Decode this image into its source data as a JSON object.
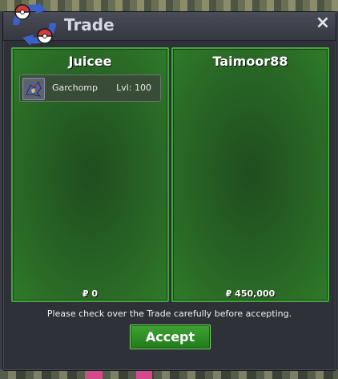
{
  "window": {
    "title": "Trade",
    "close_glyph": "×"
  },
  "left_panel": {
    "player_name": "Juicee",
    "pokemon": [
      {
        "name": "Garchomp",
        "level_text": "Lvl: 100",
        "icon": "garchomp-sprite-icon"
      }
    ],
    "money": "₽ 0"
  },
  "right_panel": {
    "player_name": "Taimoor88",
    "money": "₽ 450,000"
  },
  "footer": {
    "notice": "Please check over the Trade carefully before accepting.",
    "accept_label": "Accept"
  },
  "colors": {
    "panel_green": "#2a6a26",
    "panel_border": "#46a23e",
    "button_green": "#2f8f27",
    "window_bg": "#2f3138"
  }
}
